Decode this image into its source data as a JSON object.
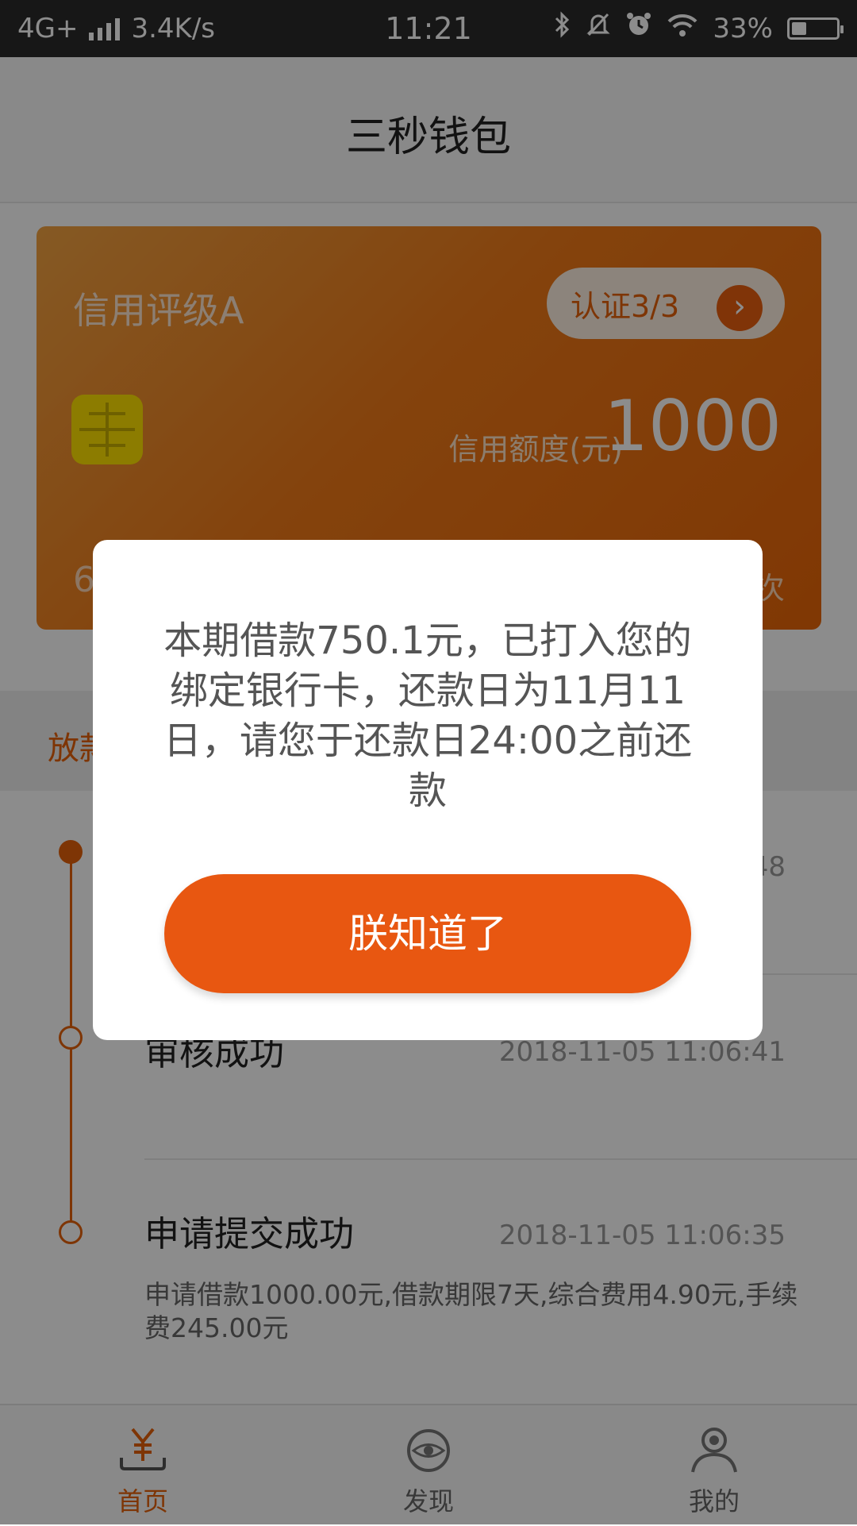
{
  "status_bar": {
    "network": "4G+",
    "speed": "3.4K/s",
    "time": "11:21",
    "battery": "33%"
  },
  "header": {
    "title": "三秒钱包"
  },
  "card": {
    "rating": "信用评级A",
    "auth_label": "认证3/3",
    "limit_label": "信用额度(元)",
    "limit_value": "1000",
    "bottom_left": "6",
    "bottom_right": "次"
  },
  "section": {
    "label": "放款"
  },
  "timeline": [
    {
      "time": "48"
    },
    {
      "title": "审核成功",
      "time": "2018-11-05 11:06:41"
    },
    {
      "title": "申请提交成功",
      "time": "2018-11-05 11:06:35",
      "desc": "申请借款1000.00元,借款期限7天,综合费用4.90元,手续费245.00元"
    }
  ],
  "tabs": [
    {
      "label": "首页",
      "icon": "yuan-icon",
      "active": true
    },
    {
      "label": "发现",
      "icon": "eye-icon",
      "active": false
    },
    {
      "label": "我的",
      "icon": "user-icon",
      "active": false
    }
  ],
  "dialog": {
    "message": "本期借款750.1元，已打入您的绑定银行卡，还款日为11月11日，请您于还款日24:00之前还款",
    "button_label": "朕知道了"
  },
  "colors": {
    "accent": "#e85711",
    "card_start": "#f3a342",
    "card_end": "#ea6608"
  }
}
